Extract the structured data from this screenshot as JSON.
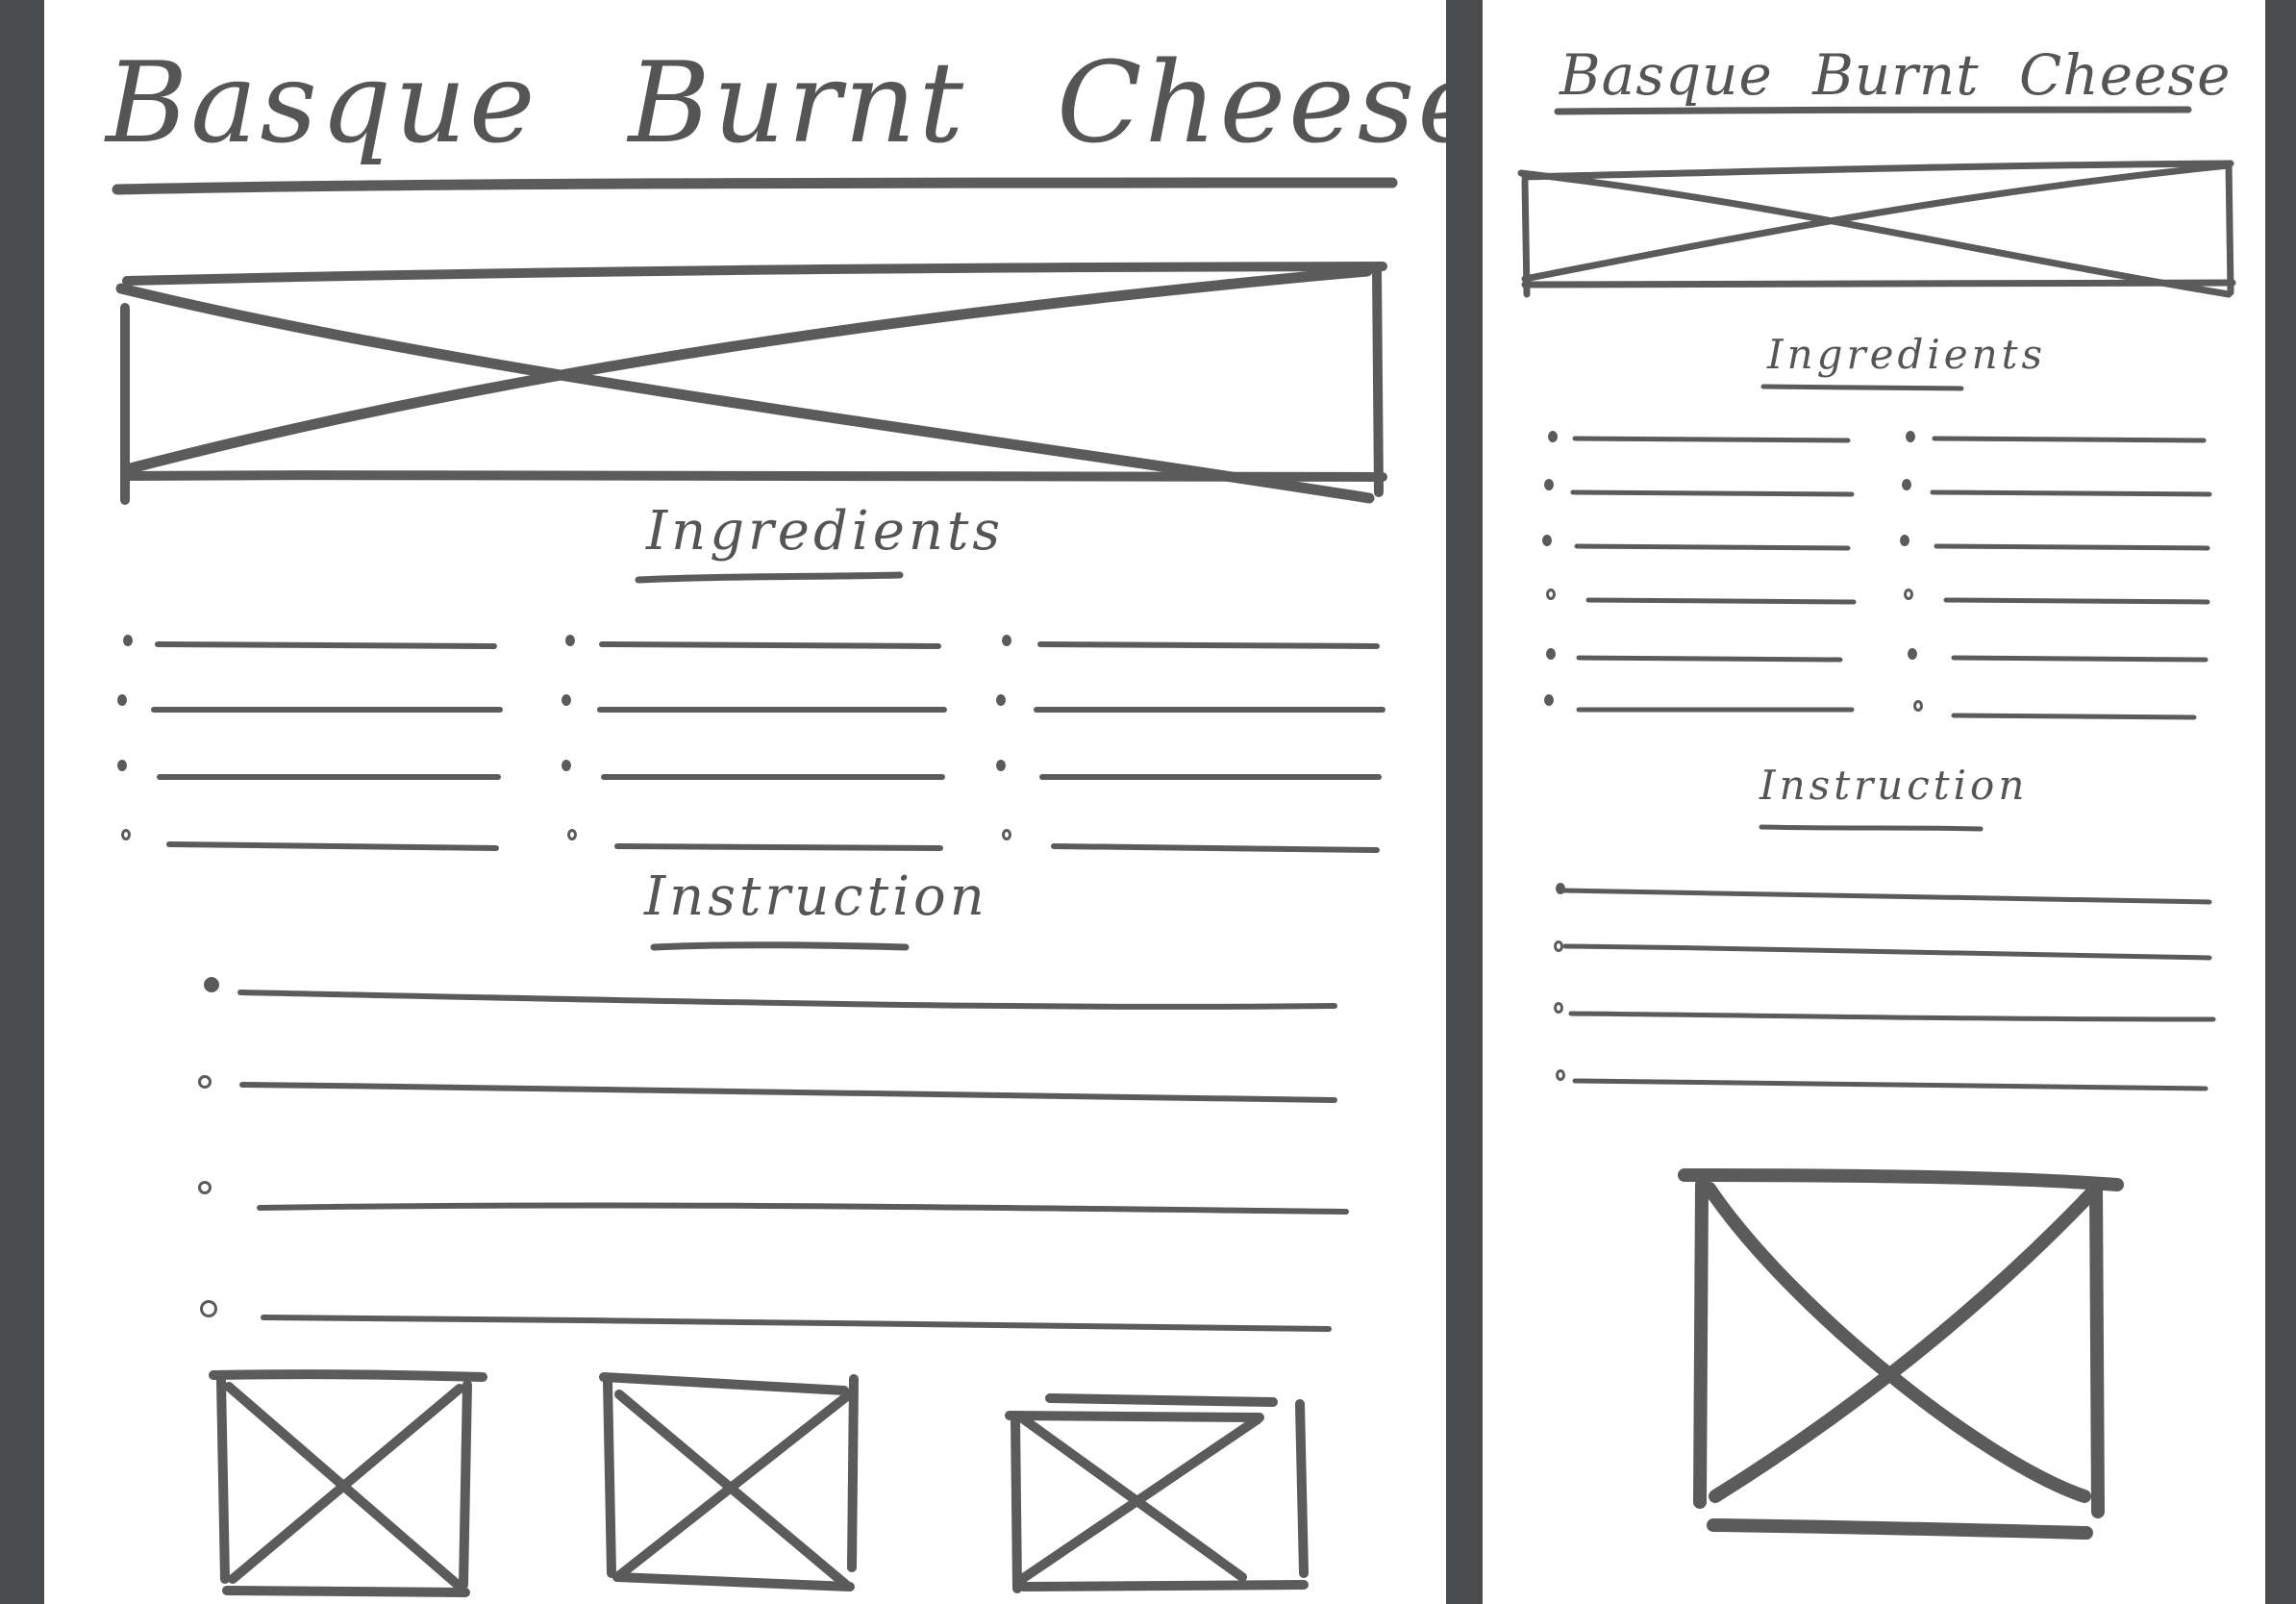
{
  "desktop": {
    "title": "Basque Burnt Cheese Cake",
    "hero_image_icon": "image-placeholder-icon",
    "ingredients_heading": "Ingredients",
    "ingredients_columns": 3,
    "ingredients_rows_per_column": 4,
    "instructions_heading": "Instruction",
    "instruction_steps": 4,
    "gallery_icon": "image-placeholder-icon",
    "gallery_images": 3
  },
  "mobile": {
    "title": "Basque Burnt Cheese Cake",
    "hero_image_icon": "image-placeholder-icon",
    "ingredients_heading": "Ingredients",
    "ingredients_columns": 2,
    "ingredients_rows_per_column": 6,
    "instructions_heading": "Instruction",
    "instruction_steps": 4,
    "bottom_image_icon": "image-placeholder-icon"
  },
  "colors": {
    "background": "#4a4b4d",
    "paper": "#ffffff",
    "ink": "#5b5b5b"
  }
}
